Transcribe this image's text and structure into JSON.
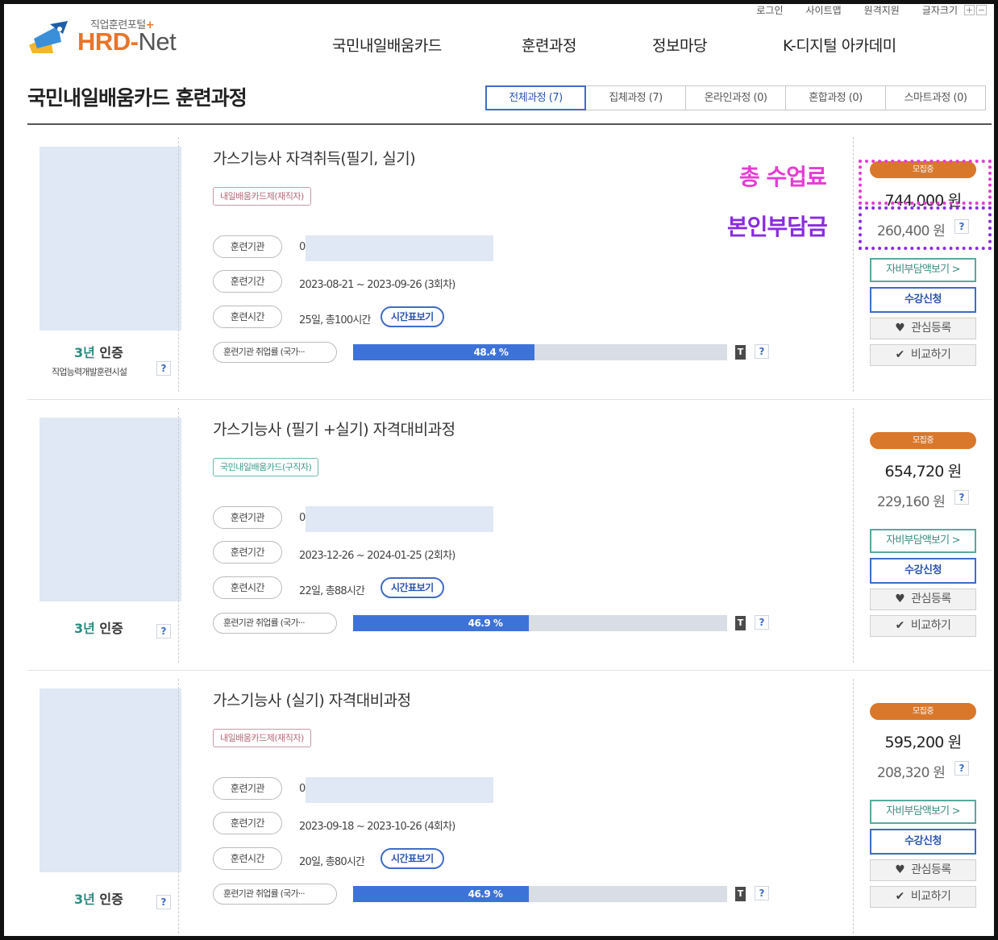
{
  "header": {
    "logo_sub": "직업훈련포털",
    "logo_plus": "+",
    "logo_hrd": "HRD-",
    "logo_net": "Net",
    "util_links": [
      "로그인",
      "사이트맵",
      "원격지원",
      "글자크기"
    ],
    "font_size_buttons": [
      "+",
      "−"
    ],
    "nav": [
      "국민내일배움카드",
      "훈련과정",
      "정보마당",
      "K-디지털 아카데미"
    ]
  },
  "page_title": "국민내일배움카드 훈련과정",
  "tabs": [
    "전체과정 (7)",
    "집체과정 (7)",
    "온라인과정 (0)",
    "혼합과정 (0)",
    "스마트과정 (0)"
  ],
  "active_tab": 0,
  "annotations": {
    "total_fee": "총 수업료",
    "self_pay": "본인부담금"
  },
  "labels": {
    "org": "훈련기관",
    "period": "훈련기간",
    "hours": "훈련시간",
    "timetable": "시간표보기",
    "employment": "훈련기관 취업률 (국가···",
    "help": "?",
    "t_icon": "T",
    "self_pay_btn": "자비부담액보기 >",
    "apply_btn": "수강신청",
    "wish_btn": "관심등록",
    "compare_btn": "비교하기",
    "cert_year": "3년",
    "cert_word": " 인증",
    "org_initial": "0"
  },
  "courses": [
    {
      "title": "가스기능사 자격취득(필기, 실기)",
      "badge": "내일배움카드제(재직자)",
      "badge_style": "red",
      "period": "2023-08-21 ~ 2023-09-26 (3회차)",
      "hours": "25일, 총100시간",
      "employment_rate": 48.4,
      "employment_label": "48.4 %",
      "status": "모집중",
      "total_price": "744,000 원",
      "self_price": "260,400 원",
      "cert_sub": "직업능력개발훈련시설"
    },
    {
      "title": "가스기능사 (필기 +실기) 자격대비과정",
      "badge": "국민내일배움카드(구직자)",
      "badge_style": "green",
      "period": "2023-12-26 ~ 2024-01-25 (2회차)",
      "hours": "22일, 총88시간",
      "employment_rate": 46.9,
      "employment_label": "46.9 %",
      "status": "모집중",
      "total_price": "654,720 원",
      "self_price": "229,160 원",
      "cert_sub": ""
    },
    {
      "title": "가스기능사 (실기) 자격대비과정",
      "badge": "내일배움카드제(재직자)",
      "badge_style": "red",
      "period": "2023-09-18 ~ 2023-10-26 (4회차)",
      "hours": "20일, 총80시간",
      "employment_rate": 46.9,
      "employment_label": "46.9 %",
      "status": "모집중",
      "total_price": "595,200 원",
      "self_price": "208,320 원",
      "cert_sub": ""
    }
  ],
  "colors": {
    "brand_orange": "#e8742a",
    "accent_blue": "#3f6cc7",
    "bar_blue": "#3d72d8",
    "status_orange": "#d9782b",
    "annotation_pink": "#e63bd4",
    "annotation_purple": "#8a2be2"
  }
}
